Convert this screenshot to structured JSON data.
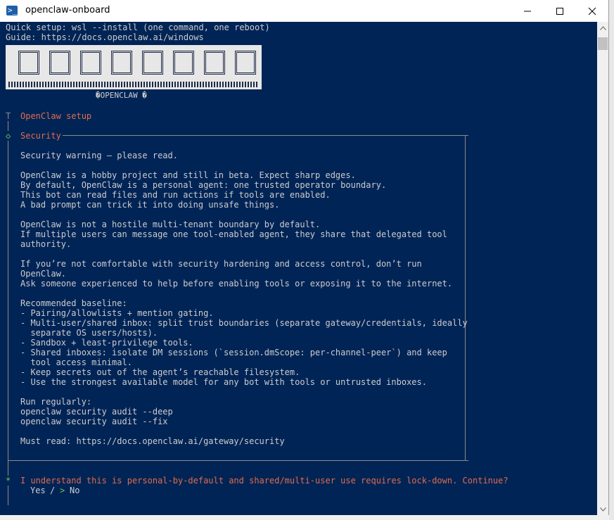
{
  "window": {
    "title": "openclaw-onboard",
    "icon": "powershell-icon",
    "controls": [
      "minimize-icon",
      "maximize-icon",
      "close-icon"
    ]
  },
  "terminal": {
    "bg_color": "#012456",
    "accent_color": "#e06c4a",
    "header_lines": [
      "Quick setup: wsl --install (one command, one reboot)",
      "Guide: https://docs.openclaw.ai/windows"
    ],
    "logo_caption": "�OPENCLAW �",
    "setup_marker": "T",
    "setup_title": "OpenClaw setup",
    "section_marker": "◇",
    "section_title": "Security",
    "body": [
      "Security warning — please read.",
      "",
      "OpenClaw is a hobby project and still in beta. Expect sharp edges.",
      "By default, OpenClaw is a personal agent: one trusted operator boundary.",
      "This bot can read files and run actions if tools are enabled.",
      "A bad prompt can trick it into doing unsafe things.",
      "",
      "OpenClaw is not a hostile multi-tenant boundary by default.",
      "If multiple users can message one tool-enabled agent, they share that delegated tool",
      "authority.",
      "",
      "If you’re not comfortable with security hardening and access control, don’t run",
      "OpenClaw.",
      "Ask someone experienced to help before enabling tools or exposing it to the internet.",
      "",
      "Recommended baseline:",
      "- Pairing/allowlists + mention gating.",
      "- Multi-user/shared inbox: split trust boundaries (separate gateway/credentials, ideally",
      "  separate OS users/hosts).",
      "- Sandbox + least-privilege tools.",
      "- Shared inboxes: isolate DM sessions (`session.dmScope: per-channel-peer`) and keep",
      "  tool access minimal.",
      "- Keep secrets out of the agent’s reachable filesystem.",
      "- Use the strongest available model for any bot with tools or untrusted inboxes.",
      "",
      "Run regularly:",
      "openclaw security audit --deep",
      "openclaw security audit --fix",
      "",
      "Must read: https://docs.openclaw.ai/gateway/security"
    ],
    "prompt_marker": "*",
    "prompt_question": "I understand this is personal-by-default and shared/multi-user use requires lock-down. Continue?",
    "options": {
      "yes": "Yes",
      "separator": "/",
      "selected_marker": ">",
      "no": "No"
    }
  }
}
